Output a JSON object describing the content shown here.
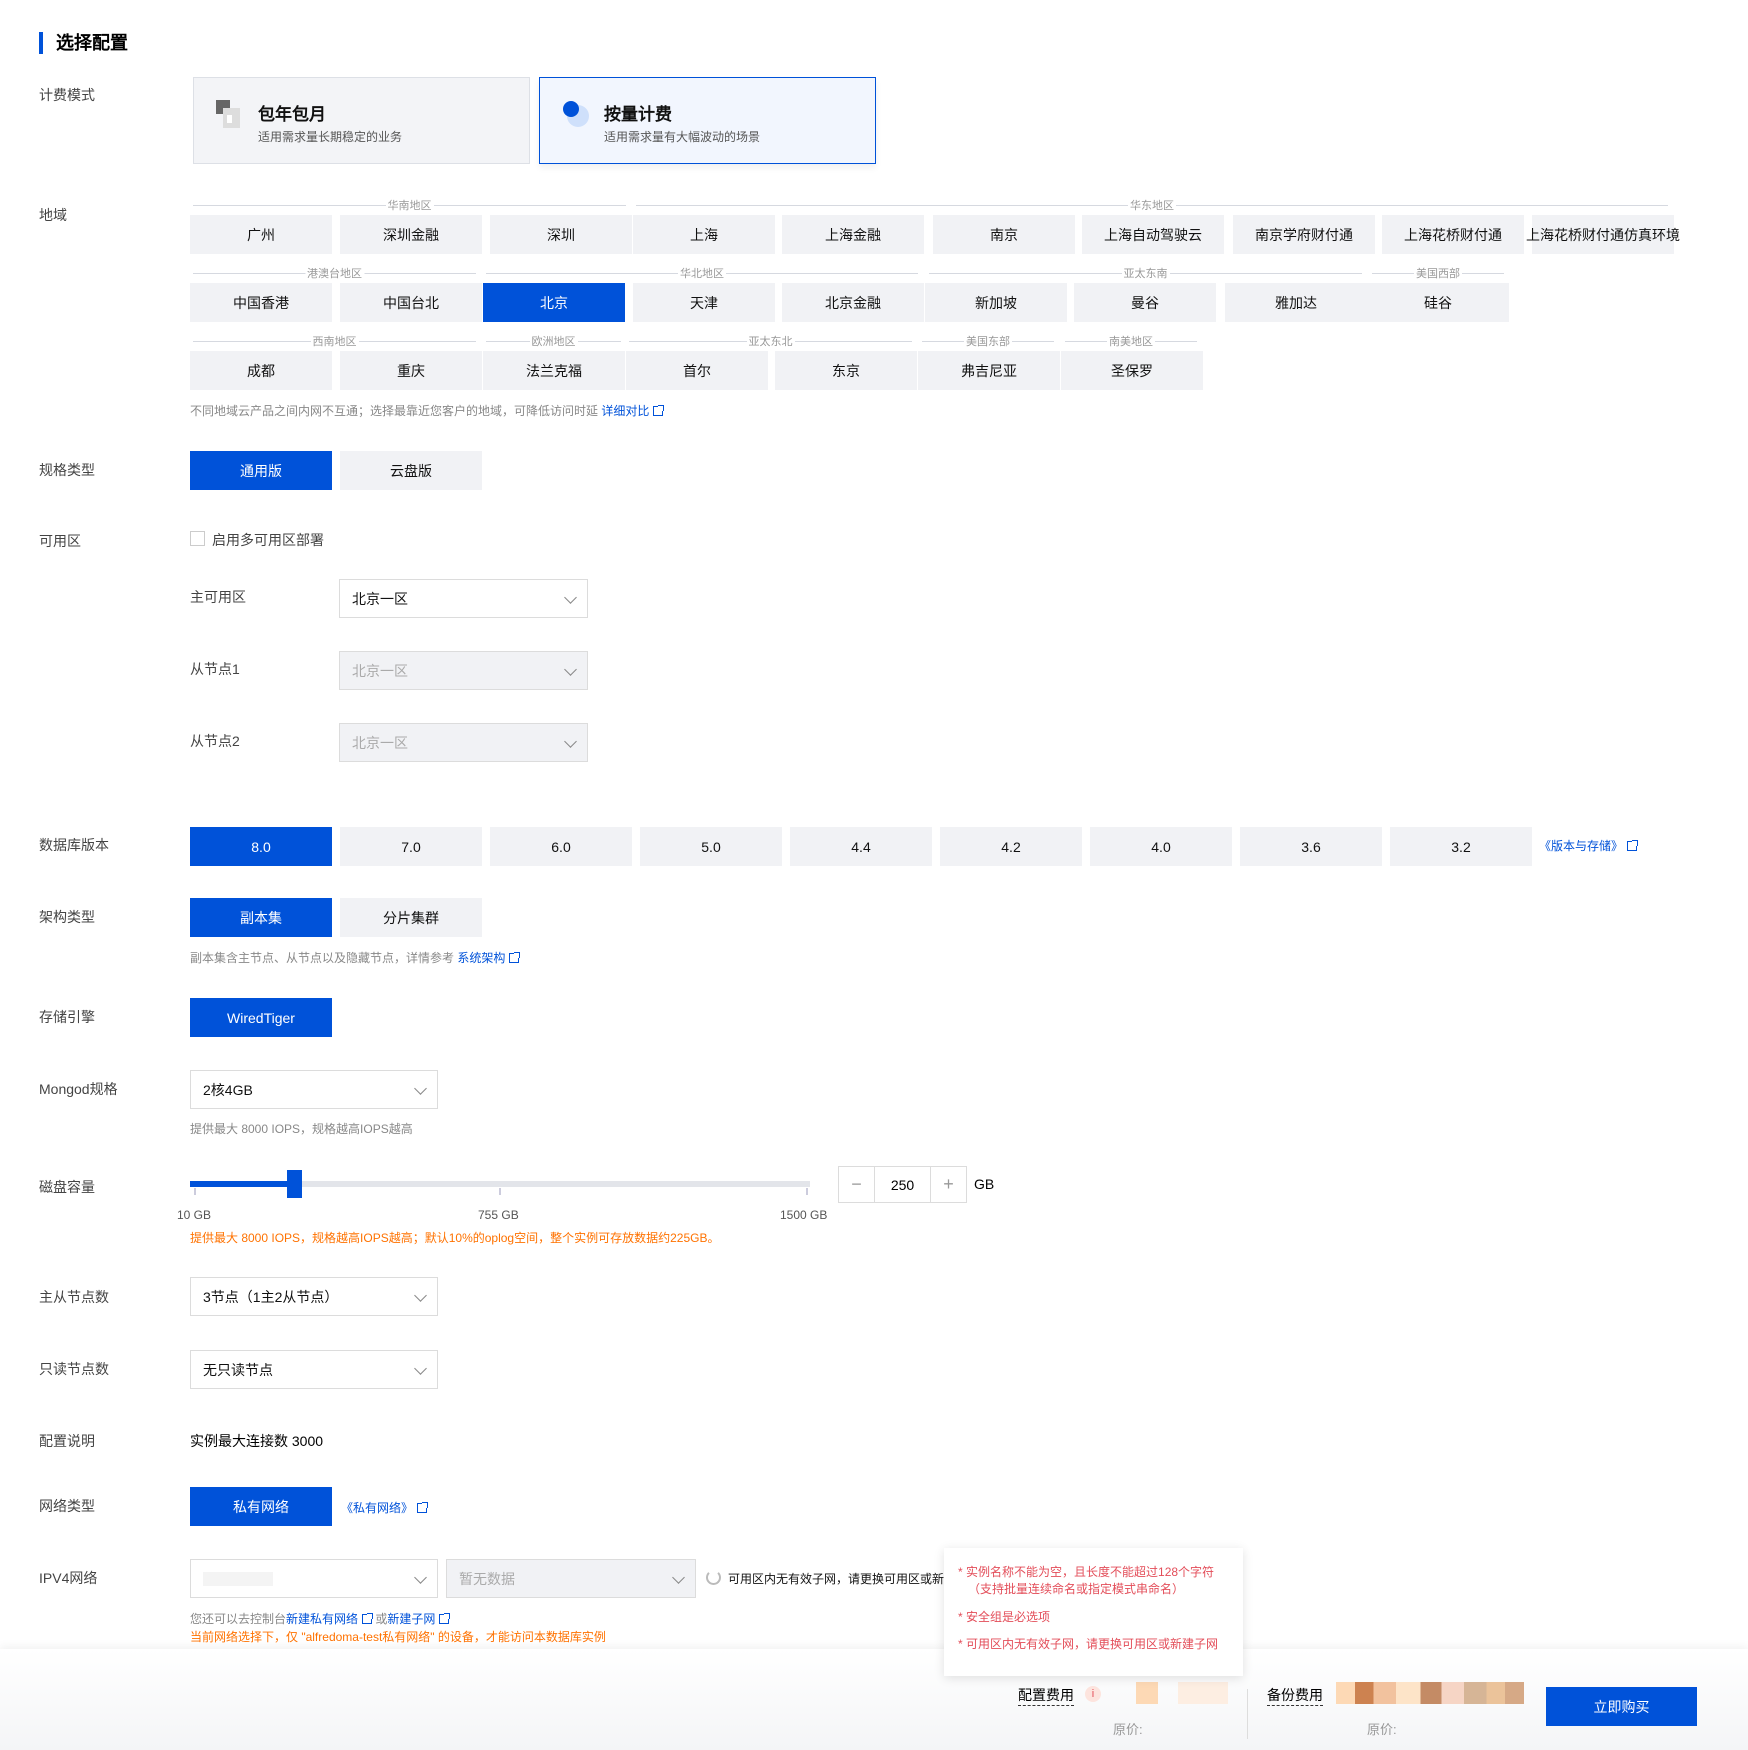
{
  "section_title": "选择配置",
  "labels": {
    "billing": "计费模式",
    "region": "地域",
    "spec_type": "规格类型",
    "zone": "可用区",
    "db_version": "数据库版本",
    "arch": "架构类型",
    "engine": "存储引擎",
    "mongod": "Mongod规格",
    "disk": "磁盘容量",
    "nodes": "主从节点数",
    "readonly": "只读节点数",
    "config_desc": "配置说明",
    "network": "网络类型",
    "ipv4": "IPV4网络"
  },
  "billing": [
    {
      "title": "包年包月",
      "desc": "适用需求量长期稳定的业务",
      "selected": false
    },
    {
      "title": "按量计费",
      "desc": "适用需求量有大幅波动的场景",
      "selected": true
    }
  ],
  "region_groups": [
    [
      "华南地区",
      "华东地区"
    ],
    [
      "港澳台地区",
      "华北地区",
      "亚太东南",
      "美国西部"
    ],
    [
      "西南地区",
      "欧洲地区",
      "亚太东北",
      "美国东部",
      "南美地区"
    ]
  ],
  "regions": [
    [
      "广州",
      "深圳金融",
      "深圳",
      "上海",
      "上海金融",
      "南京",
      "上海自动驾驶云",
      "南京学府财付通",
      "上海花桥财付通",
      "上海花桥财付通仿真环境"
    ],
    [
      "中国香港",
      "中国台北",
      "北京",
      "天津",
      "北京金融",
      "新加坡",
      "曼谷",
      "雅加达",
      "硅谷"
    ],
    [
      "成都",
      "重庆",
      "法兰克福",
      "首尔",
      "东京",
      "弗吉尼亚",
      "圣保罗"
    ]
  ],
  "selected_region": "北京",
  "region_note": "不同地域云产品之间内网不互通；选择最靠近您客户的地域，可降低访问时延",
  "region_link": "详细对比",
  "spec_types": [
    "通用版",
    "云盘版"
  ],
  "zone": {
    "multi_az": "启用多可用区部署",
    "multi_az_checked": false,
    "primary_label": "主可用区",
    "primary_value": "北京一区",
    "slave1_label": "从节点1",
    "slave1_value": "北京一区",
    "slave2_label": "从节点2",
    "slave2_value": "北京一区"
  },
  "db_versions": [
    "8.0",
    "7.0",
    "6.0",
    "5.0",
    "4.4",
    "4.2",
    "4.0",
    "3.6",
    "3.2"
  ],
  "db_version_link": "《版本与存储》",
  "arch_types": [
    "副本集",
    "分片集群"
  ],
  "arch_note": "副本集含主节点、从节点以及隐藏节点，详情参考",
  "arch_link": "系统架构",
  "engine": "WiredTiger",
  "mongod_value": "2核4GB",
  "mongod_note": "提供最大 8000 IOPS，规格越高IOPS越高",
  "disk": {
    "value": "250",
    "unit": "GB",
    "min": 10,
    "max": 1500,
    "ticks": [
      "10 GB",
      "755 GB",
      "1500 GB"
    ],
    "minus": "−",
    "plus": "+",
    "note": "提供最大 8000 IOPS，规格越高IOPS越高；默认10%的oplog空间，整个实例可存放数据约225GB。"
  },
  "nodes_value": "3节点（1主2从节点）",
  "readonly_value": "无只读节点",
  "config_desc_value": "实例最大连接数 3000",
  "network_button": "私有网络",
  "network_link": "《私有网络》",
  "ipv4": {
    "subnet_placeholder": "暂无数据",
    "hint": "可用区内无有效子网，请更换可用区或新",
    "note_prefix": "您还可以去控制台",
    "link1": "新建私有网络",
    "or": "或",
    "link2": "新建子网",
    "warning": "当前网络选择下，仅 \"alfredoma-test私有网络\" 的设备，才能访问本数据库实例"
  },
  "errors": [
    "实例名称不能为空，且长度不能超过128个字符（支持批量连续命名或指定模式串命名）",
    "安全组是必选项",
    "可用区内无有效子网，请更换可用区或新建子网"
  ],
  "footer": {
    "config_fee": "配置费用",
    "backup_fee": "备份费用",
    "orig_price": "原价:",
    "orig_price2": "原价:",
    "buy": "立即购买"
  },
  "colors": {
    "accent": "#0052d9",
    "warning": "#ff7200",
    "error": "#e34d59"
  }
}
